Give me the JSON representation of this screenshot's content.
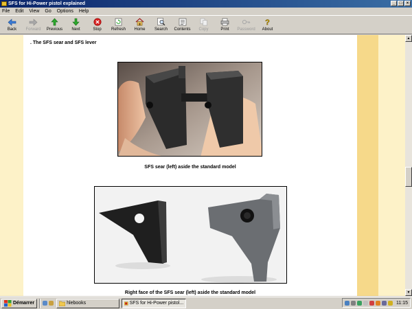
{
  "window": {
    "title": "SFS for Hi-Power pistol explained"
  },
  "menu": [
    "File",
    "Edit",
    "View",
    "Go",
    "Options",
    "Help"
  ],
  "toolbar": [
    {
      "label": "Back",
      "icon": "back-arrow-icon",
      "enabled": true
    },
    {
      "label": "Forward",
      "icon": "forward-arrow-icon",
      "enabled": false
    },
    {
      "label": "Previous",
      "icon": "up-arrow-icon",
      "enabled": true
    },
    {
      "label": "Next",
      "icon": "down-arrow-icon",
      "enabled": true
    },
    {
      "label": "Stop",
      "icon": "stop-icon",
      "enabled": true
    },
    {
      "label": "Refresh",
      "icon": "refresh-icon",
      "enabled": true
    },
    {
      "label": "Home",
      "icon": "home-icon",
      "enabled": true
    },
    {
      "label": "Search",
      "icon": "search-icon",
      "enabled": true
    },
    {
      "label": "Contents",
      "icon": "contents-icon",
      "enabled": true
    },
    {
      "label": "Copy",
      "icon": "copy-icon",
      "enabled": false
    },
    {
      "label": "Print",
      "icon": "print-icon",
      "enabled": true
    },
    {
      "label": "Password",
      "icon": "password-icon",
      "enabled": false
    },
    {
      "label": "About",
      "icon": "about-icon",
      "enabled": true
    }
  ],
  "page": {
    "heading": ". The SFS sear and SFS lever",
    "caption1": "SFS sear (left) aside the standard model",
    "caption2": "Right face of the SFS sear (left) aside the standard model"
  },
  "scrollbar": {
    "position": 0.55,
    "visible_fraction": 0.08
  },
  "taskbar": {
    "start_label": "Démarrer",
    "tasks": [
      {
        "label": "hlebooks",
        "icon": "folder-icon",
        "active": false
      },
      {
        "label": "SFS for Hi-Power pistol...",
        "icon": "ebook-icon",
        "active": true
      }
    ],
    "clock": "11:15"
  },
  "colors": {
    "page_bg": "#ffffff",
    "side_light": "#fdf2c8",
    "side_dark": "#f6d98a",
    "titlebar": "#0a246a"
  }
}
